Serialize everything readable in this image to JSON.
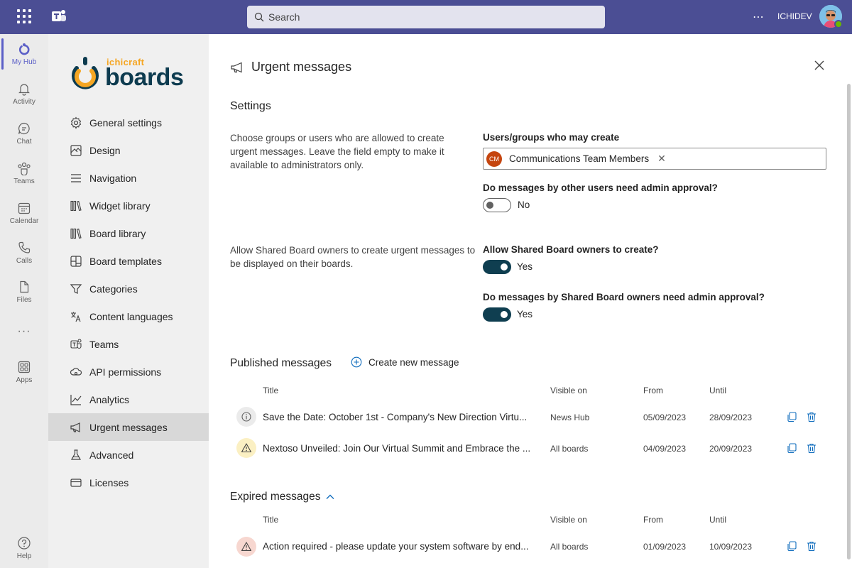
{
  "topbar": {
    "search_placeholder": "Search",
    "more": "⋯",
    "tenant": "ICHIDEV",
    "accent": "#4b4e94"
  },
  "rail": {
    "items": [
      {
        "label": "My Hub",
        "icon": "myhub-icon",
        "active": true
      },
      {
        "label": "Activity",
        "icon": "bell-icon"
      },
      {
        "label": "Chat",
        "icon": "chat-icon"
      },
      {
        "label": "Teams",
        "icon": "teams-icon"
      },
      {
        "label": "Calendar",
        "icon": "calendar-icon"
      },
      {
        "label": "Calls",
        "icon": "phone-icon"
      },
      {
        "label": "Files",
        "icon": "file-icon"
      },
      {
        "label": "Apps",
        "icon": "apps-icon"
      },
      {
        "label": "Help",
        "icon": "help-icon"
      }
    ],
    "more": "···"
  },
  "brand": {
    "top": "ichicraft",
    "main": "boards"
  },
  "nav": {
    "items": [
      {
        "label": "General settings",
        "icon": "gear-icon"
      },
      {
        "label": "Design",
        "icon": "design-icon"
      },
      {
        "label": "Navigation",
        "icon": "navigation-icon"
      },
      {
        "label": "Widget library",
        "icon": "library-icon"
      },
      {
        "label": "Board library",
        "icon": "library-icon"
      },
      {
        "label": "Board templates",
        "icon": "templates-icon"
      },
      {
        "label": "Categories",
        "icon": "filter-icon"
      },
      {
        "label": "Content languages",
        "icon": "translate-icon"
      },
      {
        "label": "Teams",
        "icon": "teams-icon"
      },
      {
        "label": "API permissions",
        "icon": "cloud-icon"
      },
      {
        "label": "Analytics",
        "icon": "chart-icon"
      },
      {
        "label": "Urgent messages",
        "icon": "megaphone-icon",
        "active": true
      },
      {
        "label": "Advanced",
        "icon": "flask-icon"
      },
      {
        "label": "Licenses",
        "icon": "card-icon"
      }
    ]
  },
  "main": {
    "title": "Urgent messages",
    "settings_heading": "Settings",
    "desc1": "Choose groups or users who are allowed to create urgent messages. Leave the field empty to make it available to administrators only.",
    "users_label": "Users/groups who may create",
    "chip": {
      "initials": "CM",
      "name": "Communications Team Members",
      "remove": "✕"
    },
    "approval_label": "Do messages by other users need admin approval?",
    "approval_value": "No",
    "desc2": "Allow Shared Board owners to create urgent messages to be displayed on their boards.",
    "shared_create_label": "Allow Shared Board owners to create?",
    "shared_create_value": "Yes",
    "shared_approval_label": "Do messages by Shared Board owners need admin approval?",
    "shared_approval_value": "Yes",
    "published_heading": "Published messages",
    "create_new": "Create new message",
    "expired_heading": "Expired messages",
    "columns": {
      "title": "Title",
      "visible_on": "Visible on",
      "from": "From",
      "until": "Until"
    },
    "published": [
      {
        "icon": "info-icon",
        "title": "Save the Date: October 1st - Company's New Direction Virtu...",
        "visible_on": "News Hub",
        "from": "05/09/2023",
        "until": "28/09/2023",
        "bg": "#ebebeb"
      },
      {
        "icon": "warning-icon",
        "title": "Nextoso Unveiled: Join Our Virtual Summit and Embrace the ...",
        "visible_on": "All boards",
        "from": "04/09/2023",
        "until": "20/09/2023",
        "bg": "#fbf0c3"
      }
    ],
    "expired": [
      {
        "icon": "warning-icon",
        "title": "Action required - please update your system software by end...",
        "visible_on": "All boards",
        "from": "01/09/2023",
        "until": "10/09/2023",
        "bg": "#f7d7d0"
      }
    ]
  }
}
